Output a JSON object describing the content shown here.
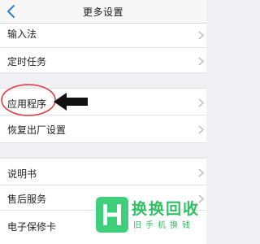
{
  "header": {
    "title": "更多设置",
    "back_icon": "chevron-left-icon"
  },
  "groups": [
    {
      "items": [
        {
          "label": "输入法"
        },
        {
          "label": "定时任务"
        }
      ]
    },
    {
      "items": [
        {
          "label": "应用程序"
        },
        {
          "label": "恢复出厂设置"
        }
      ]
    },
    {
      "items": [
        {
          "label": "说明书"
        },
        {
          "label": "售后服务"
        },
        {
          "label": "电子保修卡"
        }
      ]
    }
  ],
  "annotation": {
    "highlight_color": "#e0353b",
    "arrow_color": "#111111"
  },
  "watermark": {
    "brand": "换换回收",
    "tagline": "旧手机换钱",
    "color": "#2fc063"
  },
  "colors": {
    "accent": "#2b7fd9",
    "background": "#efeff4"
  }
}
